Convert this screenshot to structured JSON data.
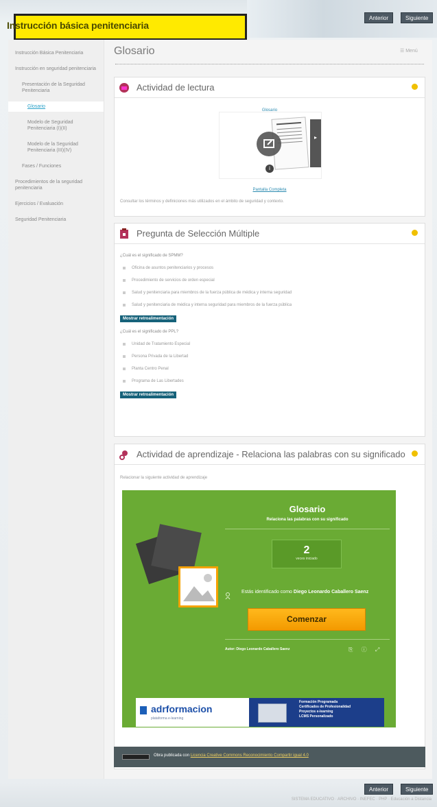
{
  "header": {
    "title": "Instrucción básica penitenciaria"
  },
  "nav": {
    "prev_label": "Anterior",
    "next_label": "Siguiente"
  },
  "sidebar": {
    "items": [
      {
        "label": "Instrucción Básica Penitenciaria",
        "level": 1
      },
      {
        "label": "Instrucción en seguridad penitenciaria",
        "level": 1
      },
      {
        "label": "Presentación de la Seguridad Penitenciaria",
        "level": 2
      },
      {
        "label": "Glosario",
        "level": 3,
        "active": true
      },
      {
        "label": "Modelo de Seguridad Penitenciaria (I)(II)",
        "level": 3
      },
      {
        "label": "Modelo de la Seguridad Penitenciaria (III)(IV)",
        "level": 3
      },
      {
        "label": "Fases / Funciones",
        "level": 2
      },
      {
        "label": "Procedimientos de la seguridad penitenciaria",
        "level": 1
      },
      {
        "label": "Ejercicios / Evaluación",
        "level": 1
      },
      {
        "label": "Seguridad Penitenciaria",
        "level": 1
      }
    ]
  },
  "main": {
    "title": "Glosario",
    "menu_label": "☰ Menú",
    "reading": {
      "title": "Actividad de lectura",
      "doc_link": "Glosario",
      "caption": "Pantalla Completa",
      "description": "Consultar los términos y definiciones más utilizados en el ámbito de seguridad y contexto."
    },
    "multiple_choice": {
      "title": "Pregunta de Selección Múltiple",
      "questions": [
        {
          "label": "¿Cuál es el significado de SPMM?",
          "options": [
            "Oficina de asuntos penitenciarios y procesos",
            "Procedimiento de servicios de orden especial",
            "Salud y penitenciaria para miembros de la fuerza pública de médica y interna seguridad",
            "Salud y penitenciaria de médica y interna seguridad para miembros de la fuerza pública"
          ],
          "feedback_label": "Mostrar retroalimentación"
        },
        {
          "label": "¿Cuál es el significado de PPL?",
          "options": [
            "Unidad de Tratamiento Especial",
            "Persona Privada de la Libertad",
            "Planta Centro Penal",
            "Programa de Las Libertades"
          ],
          "feedback_label": "Mostrar retroalimentación"
        }
      ]
    },
    "learning": {
      "title": "Actividad de aprendizaje - Relaciona las palabras con su significado",
      "intro": "Relacionar la siguiente actividad de aprendizaje",
      "game": {
        "title": "Glosario",
        "subtitle": "Relaciona las palabras con su significado",
        "count": "2",
        "count_caption": "veces iniciado",
        "identified_prefix": "Estás identificado como",
        "user_name": "Diego Leonardo Caballero Saenz",
        "start_label": "Comenzar",
        "author_label": "Autor: Diego Leonardo Caballero Saenz",
        "banner_brand": "adrformacion",
        "banner_tagline": "plataforma e-learning",
        "banner_lines": [
          "Formación Programada",
          "Certificados de Profesionalidad",
          "Proyectos e-learning",
          "LCMS Personalizado"
        ]
      },
      "license_prefix": "Obra publicada con",
      "license_link": "Licencia Creative Commons Reconocimiento Compartir igual 4.0"
    }
  },
  "footer": {
    "text": "SISTEMA EDUCATIVO · ARCHIVO · INEFEC · PHP · Educación a Distancia"
  },
  "colors": {
    "yellow": "#ffea00",
    "green": "#6aab34",
    "orange": "#f5a200",
    "teal": "#16627a"
  }
}
